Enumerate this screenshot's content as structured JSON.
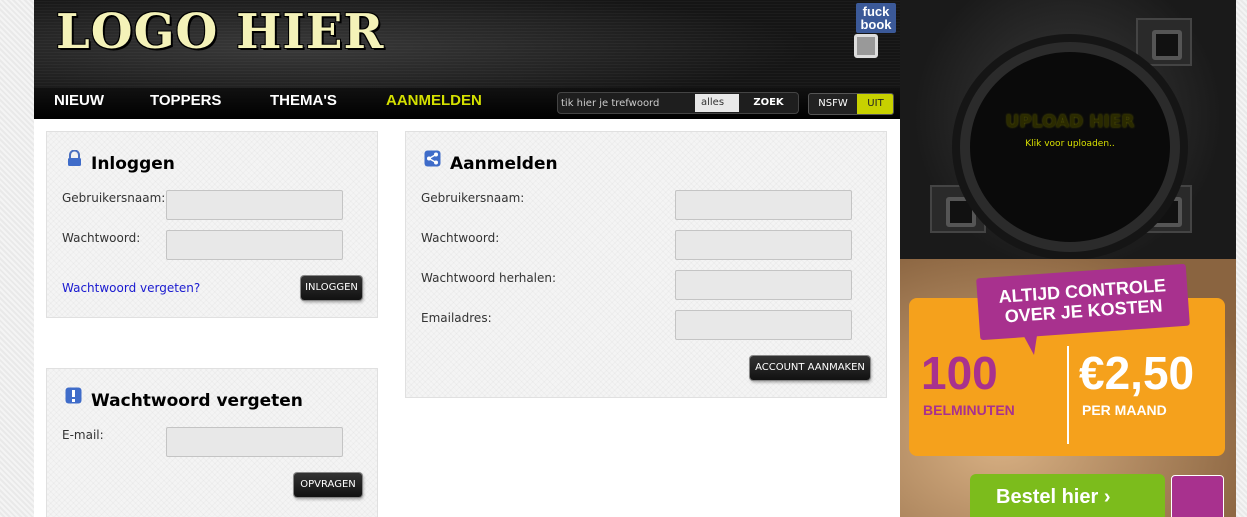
{
  "header": {
    "logo_text": "LOGO HIER",
    "fb_badge": "fuck book"
  },
  "nav": {
    "items": [
      {
        "label": "NIEUW"
      },
      {
        "label": "TOPPERS"
      },
      {
        "label": "THEMA'S"
      },
      {
        "label": "AANMELDEN",
        "active": true
      }
    ],
    "search": {
      "placeholder": "tik hier je trefwoord",
      "scope_value": "alles",
      "button_label": "ZOEK"
    },
    "nsfw": {
      "label": "NSFW",
      "state_label": "UIT"
    }
  },
  "upload": {
    "title": "UPLOAD HIER",
    "subtitle": "Klik voor uploaden.."
  },
  "login": {
    "title": "Inloggen",
    "username_label": "Gebruikersnaam:",
    "password_label": "Wachtwoord:",
    "forgot_link": "Wachtwoord vergeten?",
    "submit_label": "INLOGGEN"
  },
  "forgot": {
    "title": "Wachtwoord vergeten",
    "email_label": "E-mail:",
    "submit_label": "OPVRAGEN"
  },
  "register": {
    "title": "Aanmelden",
    "username_label": "Gebruikersnaam:",
    "password_label": "Wachtwoord:",
    "password_repeat_label": "Wachtwoord herhalen:",
    "email_label": "Emailadres:",
    "submit_label": "ACCOUNT AANMAKEN"
  },
  "ad": {
    "headline_line1": "ALTIJD CONTROLE",
    "headline_line2": "OVER JE KOSTEN",
    "left_value": "100",
    "left_unit": "BELMINUTEN",
    "right_value": "€2,50",
    "right_unit": "PER MAAND",
    "cta_label": "Bestel hier ›",
    "colors": {
      "orange": "#f5a11c",
      "purple": "#a8318e",
      "green": "#7cbc1c"
    }
  },
  "colors": {
    "accent": "#d4e000",
    "link": "#1a1ad0"
  }
}
